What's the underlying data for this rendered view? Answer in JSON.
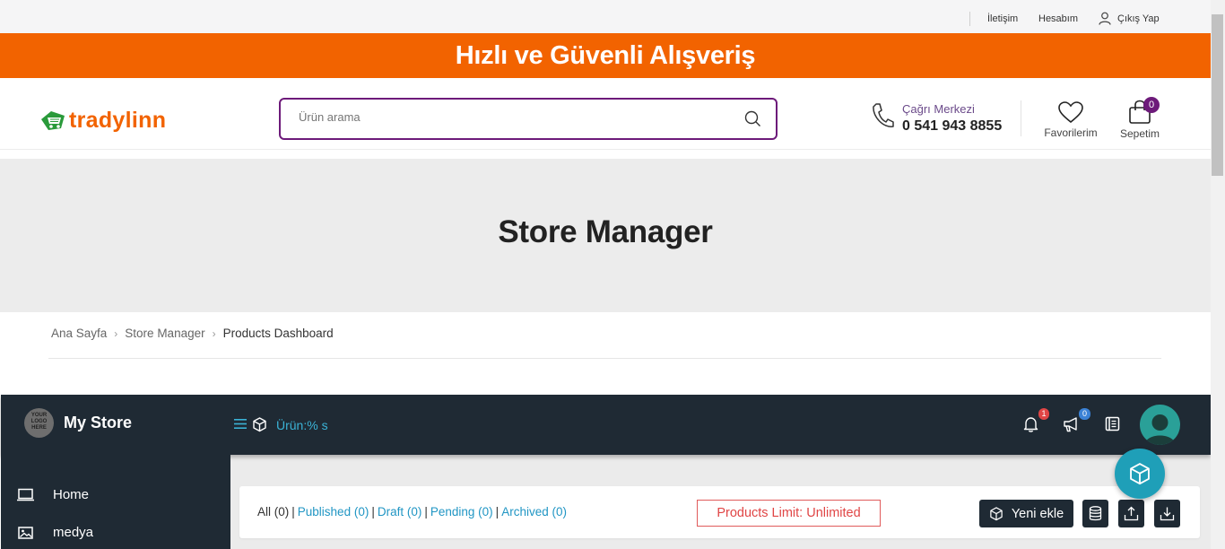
{
  "topbar": {
    "contact": "İletişim",
    "account": "Hesabım",
    "logout": "Çıkış Yap"
  },
  "banner": {
    "text": "Hızlı ve Güvenli Alışveriş"
  },
  "header": {
    "logo_text": "tradylinn",
    "search_placeholder": "Ürün arama",
    "call_center_label": "Çağrı Merkezi",
    "call_center_phone": "0 541 943 8855",
    "favorites_label": "Favorilerim",
    "cart_label": "Sepetim",
    "cart_count": "0"
  },
  "hero": {
    "title": "Store Manager"
  },
  "breadcrumb": {
    "items": [
      "Ana Sayfa",
      "Store Manager",
      "Products Dashboard"
    ]
  },
  "store": {
    "logo_text": "YOUR LOGO HERE",
    "name": "My Store",
    "products_label": "Ürün:% s",
    "notification_count": "1",
    "announcement_count": "0"
  },
  "sidebar": {
    "items": [
      {
        "label": "Home",
        "icon": "monitor-icon"
      },
      {
        "label": "medya",
        "icon": "image-icon"
      }
    ]
  },
  "products": {
    "filter_all": "All (0)",
    "filter_published": "Published (0)",
    "filter_draft": "Draft (0)",
    "filter_pending": "Pending (0)",
    "filter_archived": "Archived (0)",
    "limit_text": "Products Limit: Unlimited",
    "add_new_label": "Yeni ekle"
  },
  "colors": {
    "brand_orange": "#f26300",
    "brand_purple": "#6d1a7a",
    "dashboard_dark": "#1f2a34",
    "accent_blue": "#2196c4",
    "fab_teal": "#1f9fb8"
  }
}
